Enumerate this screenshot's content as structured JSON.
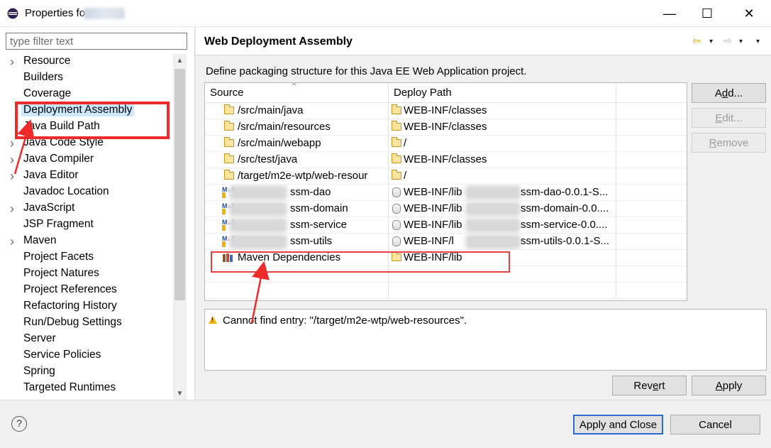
{
  "window": {
    "title": "Properties fo",
    "minimize_glyph": "—",
    "maximize_glyph": "☐",
    "close_glyph": "✕"
  },
  "filter": {
    "placeholder": "type filter text",
    "value": ""
  },
  "tree": {
    "items": [
      {
        "label": "Resource",
        "expandable": true
      },
      {
        "label": "Builders",
        "expandable": false
      },
      {
        "label": "Coverage",
        "expandable": false
      },
      {
        "label": "Deployment Assembly",
        "expandable": false,
        "selected": true
      },
      {
        "label": "Java Build Path",
        "expandable": false
      },
      {
        "label": "Java Code Style",
        "expandable": true
      },
      {
        "label": "Java Compiler",
        "expandable": true
      },
      {
        "label": "Java Editor",
        "expandable": true
      },
      {
        "label": "Javadoc Location",
        "expandable": false
      },
      {
        "label": "JavaScript",
        "expandable": true
      },
      {
        "label": "JSP Fragment",
        "expandable": false
      },
      {
        "label": "Maven",
        "expandable": true
      },
      {
        "label": "Project Facets",
        "expandable": false
      },
      {
        "label": "Project Natures",
        "expandable": false
      },
      {
        "label": "Project References",
        "expandable": false
      },
      {
        "label": "Refactoring History",
        "expandable": false
      },
      {
        "label": "Run/Debug Settings",
        "expandable": false
      },
      {
        "label": "Server",
        "expandable": false
      },
      {
        "label": "Service Policies",
        "expandable": false
      },
      {
        "label": "Spring",
        "expandable": false
      },
      {
        "label": "Targeted Runtimes",
        "expandable": false
      }
    ]
  },
  "page": {
    "title": "Web Deployment Assembly",
    "description": "Define packaging structure for this Java EE Web Application project.",
    "nav": {
      "back": "⇦",
      "forward": "⇨",
      "dropdown": "▾"
    }
  },
  "table": {
    "headers": {
      "source": "Source",
      "deploy_path": "Deploy Path"
    },
    "rows": [
      {
        "icon": "folder",
        "source": "/src/main/java",
        "deploy_icon": "folder",
        "deploy_path": "WEB-INF/classes"
      },
      {
        "icon": "folder",
        "source": "/src/main/resources",
        "deploy_icon": "folder",
        "deploy_path": "WEB-INF/classes"
      },
      {
        "icon": "folder",
        "source": "/src/main/webapp",
        "deploy_icon": "folder",
        "deploy_path": "/"
      },
      {
        "icon": "folder",
        "source": "/src/test/java",
        "deploy_icon": "folder",
        "deploy_path": "WEB-INF/classes"
      },
      {
        "icon": "folder",
        "source": "/target/m2e-wtp/web-resour",
        "deploy_icon": "folder",
        "deploy_path": "/"
      },
      {
        "icon": "project",
        "source": "ssm-dao",
        "deploy_icon": "jar",
        "deploy_path": "WEB-INF/lib",
        "deploy_suffix": "ssm-dao-0.0.1-S..."
      },
      {
        "icon": "project",
        "source": "ssm-domain",
        "deploy_icon": "jar",
        "deploy_path": "WEB-INF/lib",
        "deploy_suffix": "ssm-domain-0.0...."
      },
      {
        "icon": "project",
        "source": "ssm-service",
        "deploy_icon": "jar",
        "deploy_path": "WEB-INF/lib",
        "deploy_suffix": "ssm-service-0.0...."
      },
      {
        "icon": "project",
        "source": "ssm-utils",
        "deploy_icon": "jar",
        "deploy_path": "WEB-INF/l",
        "deploy_suffix": "ssm-utils-0.0.1-S..."
      },
      {
        "icon": "maven",
        "source": "Maven Dependencies",
        "deploy_icon": "folder",
        "deploy_path": "WEB-INF/lib"
      }
    ]
  },
  "side_buttons": {
    "add": {
      "pre": "A",
      "key": "d",
      "post": "d..."
    },
    "edit": {
      "pre": "",
      "key": "E",
      "post": "dit..."
    },
    "remove": {
      "pre": "",
      "key": "R",
      "post": "emove"
    }
  },
  "message": {
    "text": "Cannot find entry: \"/target/m2e-wtp/web-resources\"."
  },
  "page_buttons": {
    "revert": {
      "pre": "Rev",
      "key": "e",
      "post": "rt"
    },
    "apply": {
      "pre": "",
      "key": "A",
      "post": "pply"
    }
  },
  "dialog_buttons": {
    "apply_and_close": "Apply and Close",
    "cancel": "Cancel"
  },
  "help": {
    "glyph": "?"
  },
  "colors": {
    "selection": "#cce8ff",
    "annotation_red": "#ee2a2a",
    "default_button_border": "#2b6ad8"
  }
}
